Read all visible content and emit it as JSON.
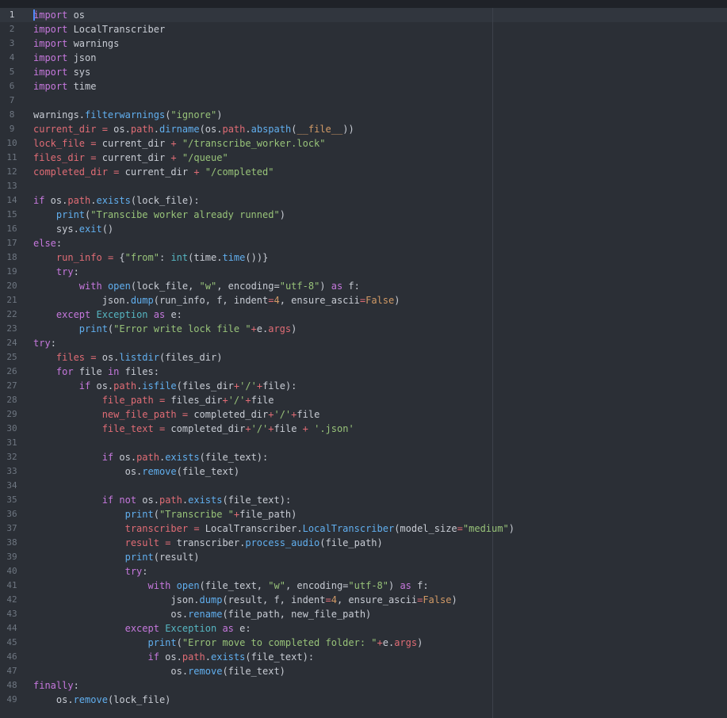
{
  "colors": {
    "background": "#2b2f36",
    "keyword": "#c678dd",
    "function": "#61afef",
    "string": "#98c379",
    "number": "#d19a66",
    "variable": "#e06c75",
    "builtin": "#56b6c2",
    "text": "#c8ccd4"
  },
  "editor": {
    "active_line": 1,
    "lines": [
      [
        [
          "kw",
          "import"
        ],
        [
          "id",
          " os"
        ]
      ],
      [
        [
          "kw",
          "import"
        ],
        [
          "id",
          " LocalTranscriber"
        ]
      ],
      [
        [
          "kw",
          "import"
        ],
        [
          "id",
          " warnings"
        ]
      ],
      [
        [
          "kw",
          "import"
        ],
        [
          "id",
          " json"
        ]
      ],
      [
        [
          "kw",
          "import"
        ],
        [
          "id",
          " sys"
        ]
      ],
      [
        [
          "kw",
          "import"
        ],
        [
          "id",
          " time"
        ]
      ],
      [],
      [
        [
          "id",
          "warnings."
        ],
        [
          "fn",
          "filterwarnings"
        ],
        [
          "id",
          "("
        ],
        [
          "str",
          "\"ignore\""
        ],
        [
          "id",
          ")"
        ]
      ],
      [
        [
          "var",
          "current_dir"
        ],
        [
          "id",
          " "
        ],
        [
          "op",
          "="
        ],
        [
          "id",
          " os."
        ],
        [
          "var",
          "path"
        ],
        [
          "id",
          "."
        ],
        [
          "fn",
          "dirname"
        ],
        [
          "id",
          "(os."
        ],
        [
          "var",
          "path"
        ],
        [
          "id",
          "."
        ],
        [
          "fn",
          "abspath"
        ],
        [
          "id",
          "("
        ],
        [
          "num",
          "__file__"
        ],
        [
          "id",
          "))"
        ]
      ],
      [
        [
          "var",
          "lock_file"
        ],
        [
          "id",
          " "
        ],
        [
          "op",
          "="
        ],
        [
          "id",
          " current_dir "
        ],
        [
          "op",
          "+"
        ],
        [
          "id",
          " "
        ],
        [
          "str",
          "\"/transcribe_worker.lock\""
        ]
      ],
      [
        [
          "var",
          "files_dir"
        ],
        [
          "id",
          " "
        ],
        [
          "op",
          "="
        ],
        [
          "id",
          " current_dir "
        ],
        [
          "op",
          "+"
        ],
        [
          "id",
          " "
        ],
        [
          "str",
          "\"/queue\""
        ]
      ],
      [
        [
          "var",
          "completed_dir"
        ],
        [
          "id",
          " "
        ],
        [
          "op",
          "="
        ],
        [
          "id",
          " current_dir "
        ],
        [
          "op",
          "+"
        ],
        [
          "id",
          " "
        ],
        [
          "str",
          "\"/completed\""
        ]
      ],
      [],
      [
        [
          "kw",
          "if"
        ],
        [
          "id",
          " os."
        ],
        [
          "var",
          "path"
        ],
        [
          "id",
          "."
        ],
        [
          "fn",
          "exists"
        ],
        [
          "id",
          "(lock_file):"
        ]
      ],
      [
        [
          "id",
          "    "
        ],
        [
          "fn",
          "print"
        ],
        [
          "id",
          "("
        ],
        [
          "str",
          "\"Transcibe worker already runned\""
        ],
        [
          "id",
          ")"
        ]
      ],
      [
        [
          "id",
          "    sys."
        ],
        [
          "fn",
          "exit"
        ],
        [
          "id",
          "()"
        ]
      ],
      [
        [
          "kw",
          "else"
        ],
        [
          "id",
          ":"
        ]
      ],
      [
        [
          "id",
          "    "
        ],
        [
          "var",
          "run_info"
        ],
        [
          "id",
          " "
        ],
        [
          "op",
          "="
        ],
        [
          "id",
          " {"
        ],
        [
          "str",
          "\"from\""
        ],
        [
          "id",
          ": "
        ],
        [
          "bi",
          "int"
        ],
        [
          "id",
          "(time."
        ],
        [
          "fn",
          "time"
        ],
        [
          "id",
          "())}"
        ]
      ],
      [
        [
          "id",
          "    "
        ],
        [
          "kw",
          "try"
        ],
        [
          "id",
          ":"
        ]
      ],
      [
        [
          "id",
          "        "
        ],
        [
          "kw",
          "with"
        ],
        [
          "id",
          " "
        ],
        [
          "fn",
          "open"
        ],
        [
          "id",
          "(lock_file, "
        ],
        [
          "str",
          "\"w\""
        ],
        [
          "id",
          ", encoding="
        ],
        [
          "str",
          "\"utf-8\""
        ],
        [
          "id",
          ") "
        ],
        [
          "kw",
          "as"
        ],
        [
          "id",
          " f:"
        ]
      ],
      [
        [
          "id",
          "            json."
        ],
        [
          "fn",
          "dump"
        ],
        [
          "id",
          "(run_info, f, indent"
        ],
        [
          "op",
          "="
        ],
        [
          "num",
          "4"
        ],
        [
          "id",
          ", ensure_ascii"
        ],
        [
          "op",
          "="
        ],
        [
          "num",
          "False"
        ],
        [
          "id",
          ")"
        ]
      ],
      [
        [
          "id",
          "    "
        ],
        [
          "kw",
          "except"
        ],
        [
          "id",
          " "
        ],
        [
          "bi",
          "Exception"
        ],
        [
          "id",
          " "
        ],
        [
          "kw",
          "as"
        ],
        [
          "id",
          " e:"
        ]
      ],
      [
        [
          "id",
          "        "
        ],
        [
          "fn",
          "print"
        ],
        [
          "id",
          "("
        ],
        [
          "str",
          "\"Error write lock file \""
        ],
        [
          "op",
          "+"
        ],
        [
          "id",
          "e."
        ],
        [
          "var",
          "args"
        ],
        [
          "id",
          ")"
        ]
      ],
      [
        [
          "kw",
          "try"
        ],
        [
          "id",
          ":"
        ]
      ],
      [
        [
          "id",
          "    "
        ],
        [
          "var",
          "files"
        ],
        [
          "id",
          " "
        ],
        [
          "op",
          "="
        ],
        [
          "id",
          " os."
        ],
        [
          "fn",
          "listdir"
        ],
        [
          "id",
          "(files_dir)"
        ]
      ],
      [
        [
          "id",
          "    "
        ],
        [
          "kw",
          "for"
        ],
        [
          "id",
          " file "
        ],
        [
          "kw",
          "in"
        ],
        [
          "id",
          " files:"
        ]
      ],
      [
        [
          "id",
          "        "
        ],
        [
          "kw",
          "if"
        ],
        [
          "id",
          " os."
        ],
        [
          "var",
          "path"
        ],
        [
          "id",
          "."
        ],
        [
          "fn",
          "isfile"
        ],
        [
          "id",
          "(files_dir"
        ],
        [
          "op",
          "+"
        ],
        [
          "str",
          "'/'"
        ],
        [
          "op",
          "+"
        ],
        [
          "id",
          "file):"
        ]
      ],
      [
        [
          "id",
          "            "
        ],
        [
          "var",
          "file_path"
        ],
        [
          "id",
          " "
        ],
        [
          "op",
          "="
        ],
        [
          "id",
          " files_dir"
        ],
        [
          "op",
          "+"
        ],
        [
          "str",
          "'/'"
        ],
        [
          "op",
          "+"
        ],
        [
          "id",
          "file"
        ]
      ],
      [
        [
          "id",
          "            "
        ],
        [
          "var",
          "new_file_path"
        ],
        [
          "id",
          " "
        ],
        [
          "op",
          "="
        ],
        [
          "id",
          " completed_dir"
        ],
        [
          "op",
          "+"
        ],
        [
          "str",
          "'/'"
        ],
        [
          "op",
          "+"
        ],
        [
          "id",
          "file"
        ]
      ],
      [
        [
          "id",
          "            "
        ],
        [
          "var",
          "file_text"
        ],
        [
          "id",
          " "
        ],
        [
          "op",
          "="
        ],
        [
          "id",
          " completed_dir"
        ],
        [
          "op",
          "+"
        ],
        [
          "str",
          "'/'"
        ],
        [
          "op",
          "+"
        ],
        [
          "id",
          "file "
        ],
        [
          "op",
          "+"
        ],
        [
          "id",
          " "
        ],
        [
          "str",
          "'.json'"
        ]
      ],
      [],
      [
        [
          "id",
          "            "
        ],
        [
          "kw",
          "if"
        ],
        [
          "id",
          " os."
        ],
        [
          "var",
          "path"
        ],
        [
          "id",
          "."
        ],
        [
          "fn",
          "exists"
        ],
        [
          "id",
          "(file_text):"
        ]
      ],
      [
        [
          "id",
          "                os."
        ],
        [
          "fn",
          "remove"
        ],
        [
          "id",
          "(file_text)"
        ]
      ],
      [],
      [
        [
          "id",
          "            "
        ],
        [
          "kw",
          "if"
        ],
        [
          "id",
          " "
        ],
        [
          "kw",
          "not"
        ],
        [
          "id",
          " os."
        ],
        [
          "var",
          "path"
        ],
        [
          "id",
          "."
        ],
        [
          "fn",
          "exists"
        ],
        [
          "id",
          "(file_text):"
        ]
      ],
      [
        [
          "id",
          "                "
        ],
        [
          "fn",
          "print"
        ],
        [
          "id",
          "("
        ],
        [
          "str",
          "\"Transcribe \""
        ],
        [
          "op",
          "+"
        ],
        [
          "id",
          "file_path)"
        ]
      ],
      [
        [
          "id",
          "                "
        ],
        [
          "var",
          "transcriber"
        ],
        [
          "id",
          " "
        ],
        [
          "op",
          "="
        ],
        [
          "id",
          " LocalTranscriber."
        ],
        [
          "fn",
          "LocalTranscriber"
        ],
        [
          "id",
          "(model_size"
        ],
        [
          "op",
          "="
        ],
        [
          "str",
          "\"medium\""
        ],
        [
          "id",
          ")"
        ]
      ],
      [
        [
          "id",
          "                "
        ],
        [
          "var",
          "result"
        ],
        [
          "id",
          " "
        ],
        [
          "op",
          "="
        ],
        [
          "id",
          " transcriber."
        ],
        [
          "fn",
          "process_audio"
        ],
        [
          "id",
          "(file_path)"
        ]
      ],
      [
        [
          "id",
          "                "
        ],
        [
          "fn",
          "print"
        ],
        [
          "id",
          "(result)"
        ]
      ],
      [
        [
          "id",
          "                "
        ],
        [
          "kw",
          "try"
        ],
        [
          "id",
          ":"
        ]
      ],
      [
        [
          "id",
          "                    "
        ],
        [
          "kw",
          "with"
        ],
        [
          "id",
          " "
        ],
        [
          "fn",
          "open"
        ],
        [
          "id",
          "(file_text, "
        ],
        [
          "str",
          "\"w\""
        ],
        [
          "id",
          ", encoding="
        ],
        [
          "str",
          "\"utf-8\""
        ],
        [
          "id",
          ") "
        ],
        [
          "kw",
          "as"
        ],
        [
          "id",
          " f:"
        ]
      ],
      [
        [
          "id",
          "                        json."
        ],
        [
          "fn",
          "dump"
        ],
        [
          "id",
          "(result, f, indent"
        ],
        [
          "op",
          "="
        ],
        [
          "num",
          "4"
        ],
        [
          "id",
          ", ensure_ascii"
        ],
        [
          "op",
          "="
        ],
        [
          "num",
          "False"
        ],
        [
          "id",
          ")"
        ]
      ],
      [
        [
          "id",
          "                        os."
        ],
        [
          "fn",
          "rename"
        ],
        [
          "id",
          "(file_path, new_file_path)"
        ]
      ],
      [
        [
          "id",
          "                "
        ],
        [
          "kw",
          "except"
        ],
        [
          "id",
          " "
        ],
        [
          "bi",
          "Exception"
        ],
        [
          "id",
          " "
        ],
        [
          "kw",
          "as"
        ],
        [
          "id",
          " e:"
        ]
      ],
      [
        [
          "id",
          "                    "
        ],
        [
          "fn",
          "print"
        ],
        [
          "id",
          "("
        ],
        [
          "str",
          "\"Error move to completed folder: \""
        ],
        [
          "op",
          "+"
        ],
        [
          "id",
          "e."
        ],
        [
          "var",
          "args"
        ],
        [
          "id",
          ")"
        ]
      ],
      [
        [
          "id",
          "                    "
        ],
        [
          "kw",
          "if"
        ],
        [
          "id",
          " os."
        ],
        [
          "var",
          "path"
        ],
        [
          "id",
          "."
        ],
        [
          "fn",
          "exists"
        ],
        [
          "id",
          "(file_text):"
        ]
      ],
      [
        [
          "id",
          "                        os."
        ],
        [
          "fn",
          "remove"
        ],
        [
          "id",
          "(file_text)"
        ]
      ],
      [
        [
          "kw",
          "finally"
        ],
        [
          "id",
          ":"
        ]
      ],
      [
        [
          "id",
          "    os."
        ],
        [
          "fn",
          "remove"
        ],
        [
          "id",
          "(lock_file)"
        ]
      ]
    ]
  }
}
